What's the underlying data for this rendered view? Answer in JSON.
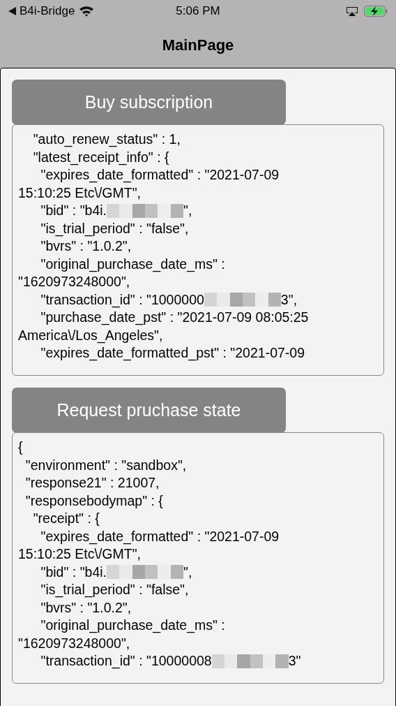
{
  "status_bar": {
    "back_app": "B4i-Bridge",
    "time": "5:06 PM"
  },
  "nav_bar": {
    "title": "MainPage"
  },
  "sections": [
    {
      "button": "Buy subscription",
      "lines": [
        {
          "text": "    \"auto_renew_status\" : 1,"
        },
        {
          "text": "    \"latest_receipt_info\" : {"
        },
        {
          "text": "      \"expires_date_formatted\" : \"2021-07-09"
        },
        {
          "text": "15:10:25 Etc\\/GMT\","
        },
        {
          "text": "      \"bid\" : \"b4i.",
          "redacted": true,
          "tail": "\","
        },
        {
          "text": "      \"is_trial_period\" : \"false\","
        },
        {
          "text": "      \"bvrs\" : \"1.0.2\","
        },
        {
          "text": "      \"original_purchase_date_ms\" :"
        },
        {
          "text": "\"1620973248000\","
        },
        {
          "text": "      \"transaction_id\" : \"1000000",
          "redacted": true,
          "tail": "3\","
        },
        {
          "text": "      \"purchase_date_pst\" : \"2021-07-09 08:05:25"
        },
        {
          "text": "America\\/Los_Angeles\","
        },
        {
          "text": "      \"expires_date_formatted_pst\" : \"2021-07-09"
        }
      ]
    },
    {
      "button": "Request pruchase state",
      "lines": [
        {
          "text": "{"
        },
        {
          "text": "  \"environment\" : \"sandbox\","
        },
        {
          "text": "  \"response21\" : 21007,"
        },
        {
          "text": "  \"responsebodymap\" : {"
        },
        {
          "text": "    \"receipt\" : {"
        },
        {
          "text": "      \"expires_date_formatted\" : \"2021-07-09"
        },
        {
          "text": "15:10:25 Etc\\/GMT\","
        },
        {
          "text": "      \"bid\" : \"b4i.",
          "redacted": true,
          "tail": "\","
        },
        {
          "text": "      \"is_trial_period\" : \"false\","
        },
        {
          "text": "      \"bvrs\" : \"1.0.2\","
        },
        {
          "text": "      \"original_purchase_date_ms\" :"
        },
        {
          "text": "\"1620973248000\","
        },
        {
          "text": "      \"transaction_id\" : \"10000008",
          "redacted": true,
          "tail": "3\""
        }
      ]
    }
  ]
}
